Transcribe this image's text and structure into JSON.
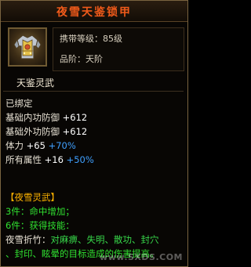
{
  "title": "夜雪天鉴锁甲",
  "info": {
    "level_label": "携带等级：",
    "level_value": "85级",
    "grade_label": "品阶：",
    "grade_value": "天阶"
  },
  "set_name": "天鉴灵武",
  "bound": "已绑定",
  "stats": {
    "inner_def_label": "基础内功防御",
    "inner_def_value": "+612",
    "outer_def_label": "基础外功防御",
    "outer_def_value": "+612",
    "stamina_label": "体力",
    "stamina_value": "+65",
    "stamina_pct": "+70%",
    "all_label": "所有属性",
    "all_value": "+16",
    "all_pct": "+50%"
  },
  "set_bonus": {
    "header": "【夜雪灵武】",
    "piece3": "3件：命中增加；",
    "piece6": "6件：获得技能：",
    "skill_name": "夜雪折竹：",
    "skill_desc1": "对麻痹、失明、散功、封穴",
    "skill_desc2": "、封印、眩晕的目标造成的伤害提高。"
  },
  "watermark": "www.SXDS.COM",
  "colors": {
    "title": "#f05a1a",
    "set_header": "#ffb400",
    "set_text": "#30e030",
    "percent": "#3fa0ff"
  },
  "icon": "armor-icon"
}
